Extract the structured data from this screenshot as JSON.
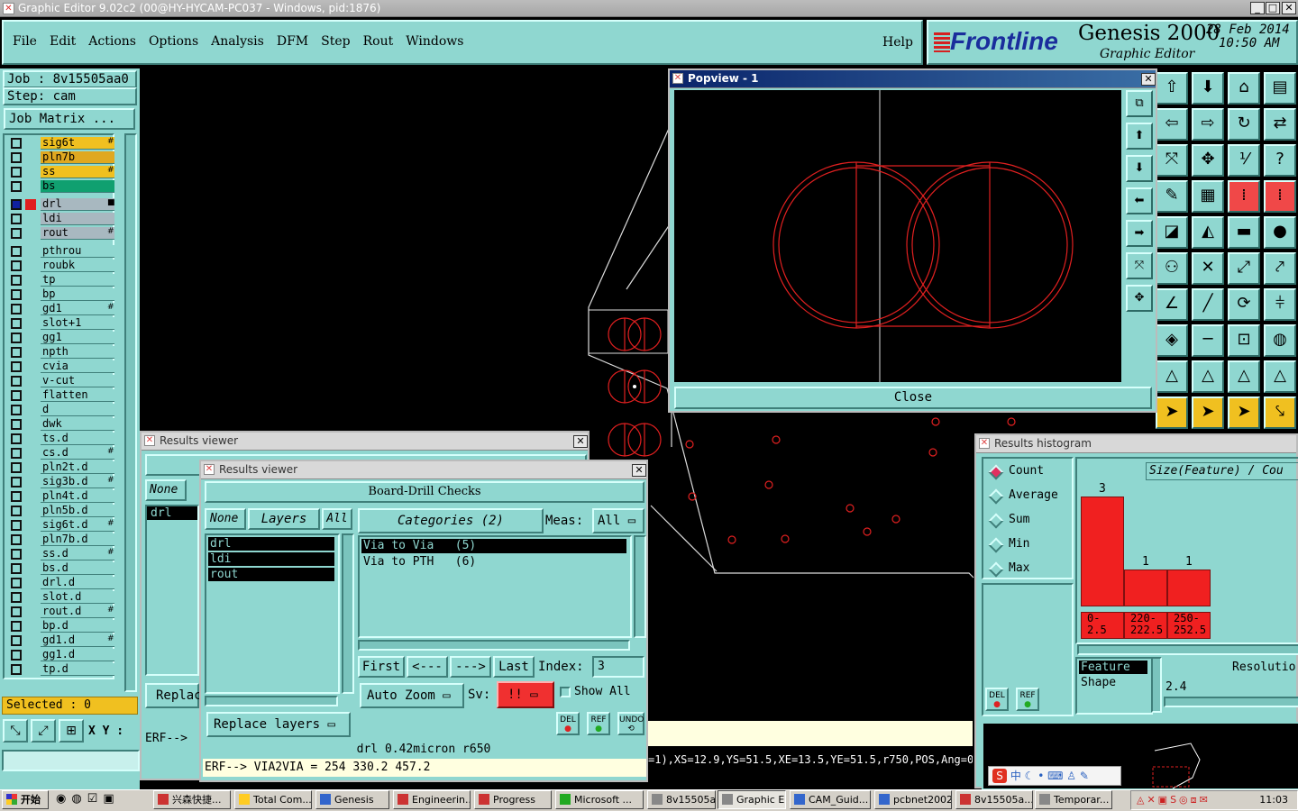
{
  "window": {
    "title": "Graphic Editor 9.02c2 (00@HY-HYCAM-PC037 - Windows, pid:1876)"
  },
  "menu": [
    "File",
    "Edit",
    "Actions",
    "Options",
    "Analysis",
    "DFM",
    "Step",
    "Rout",
    "Windows"
  ],
  "help": "Help",
  "brand": {
    "logo": "Frontline",
    "product": "Genesis 2000",
    "subtitle": "Graphic Editor",
    "date": "28 Feb 2014",
    "time": "10:50 AM"
  },
  "job": {
    "job_label": "Job : 8v15505aa0",
    "step_label": "Step: cam",
    "matrix_button": "Job Matrix ..."
  },
  "layers": [
    {
      "name": "sig6t",
      "color": "#f0c020",
      "mark": "#"
    },
    {
      "name": "pln7b",
      "color": "#e0a820",
      "mark": ""
    },
    {
      "name": "ss",
      "color": "#f0c020",
      "mark": "#"
    },
    {
      "name": "bs",
      "color": "#10a070",
      "mark": ""
    },
    {
      "name": "drl",
      "color": "#a8b8c0",
      "mark": "■",
      "active": true
    },
    {
      "name": "ldi",
      "color": "#a8b8c0",
      "mark": ""
    },
    {
      "name": "rout",
      "color": "#a8b8c0",
      "mark": "#"
    },
    {
      "name": "pthrou",
      "color": "#8fd7d0",
      "mark": ""
    },
    {
      "name": "roubk",
      "color": "#8fd7d0",
      "mark": ""
    },
    {
      "name": "tp",
      "color": "#8fd7d0",
      "mark": ""
    },
    {
      "name": "bp",
      "color": "#8fd7d0",
      "mark": ""
    },
    {
      "name": "gd1",
      "color": "#8fd7d0",
      "mark": "#"
    },
    {
      "name": "slot+1",
      "color": "#8fd7d0",
      "mark": ""
    },
    {
      "name": "gg1",
      "color": "#8fd7d0",
      "mark": ""
    },
    {
      "name": "npth",
      "color": "#8fd7d0",
      "mark": ""
    },
    {
      "name": "cvia",
      "color": "#8fd7d0",
      "mark": ""
    },
    {
      "name": "v-cut",
      "color": "#8fd7d0",
      "mark": ""
    },
    {
      "name": "flatten",
      "color": "#8fd7d0",
      "mark": ""
    },
    {
      "name": "d",
      "color": "#8fd7d0",
      "mark": ""
    },
    {
      "name": "dwk",
      "color": "#8fd7d0",
      "mark": ""
    },
    {
      "name": "ts.d",
      "color": "#8fd7d0",
      "mark": ""
    },
    {
      "name": "cs.d",
      "color": "#8fd7d0",
      "mark": "#"
    },
    {
      "name": "pln2t.d",
      "color": "#8fd7d0",
      "mark": ""
    },
    {
      "name": "sig3b.d",
      "color": "#8fd7d0",
      "mark": "#"
    },
    {
      "name": "pln4t.d",
      "color": "#8fd7d0",
      "mark": ""
    },
    {
      "name": "pln5b.d",
      "color": "#8fd7d0",
      "mark": ""
    },
    {
      "name": "sig6t.d",
      "color": "#8fd7d0",
      "mark": "#"
    },
    {
      "name": "pln7b.d",
      "color": "#8fd7d0",
      "mark": ""
    },
    {
      "name": "ss.d",
      "color": "#8fd7d0",
      "mark": "#"
    },
    {
      "name": "bs.d",
      "color": "#8fd7d0",
      "mark": ""
    },
    {
      "name": "drl.d",
      "color": "#8fd7d0",
      "mark": ""
    },
    {
      "name": "slot.d",
      "color": "#8fd7d0",
      "mark": ""
    },
    {
      "name": "rout.d",
      "color": "#8fd7d0",
      "mark": "#"
    },
    {
      "name": "bp.d",
      "color": "#8fd7d0",
      "mark": ""
    },
    {
      "name": "gd1.d",
      "color": "#8fd7d0",
      "mark": "#"
    },
    {
      "name": "gg1.d",
      "color": "#8fd7d0",
      "mark": ""
    },
    {
      "name": "tp.d",
      "color": "#8fd7d0",
      "mark": ""
    }
  ],
  "selected": "Selected : 0",
  "xy_label": "X Y :",
  "popview": {
    "title": "Popview - 1",
    "close": "Close"
  },
  "results_back": {
    "title": "Results viewer",
    "none": "None",
    "item": "drl",
    "replace": "Replac",
    "erf": "ERF-->"
  },
  "results": {
    "title": "Results viewer",
    "heading": "Board-Drill Checks",
    "none": "None",
    "layers": "Layers",
    "all": "All",
    "categories": "Categories (2)",
    "meas_label": "Meas:",
    "meas_value": "All",
    "layer_items": [
      "drl",
      "ldi",
      "rout"
    ],
    "category_items": [
      "Via to Via   (5)",
      "Via to PTH   (6)"
    ],
    "first": "First",
    "prev": "<---",
    "next": "--->",
    "last": "Last",
    "index_label": "Index:",
    "index_value": "3",
    "auto_zoom": "Auto Zoom",
    "sv": "Sv:",
    "sv_value": "!!",
    "show_all": "Show All",
    "replace_layers": "Replace layers",
    "del": "DEL",
    "ref": "REF",
    "undo": "UNDO",
    "status": "drl 0.42micron  r650",
    "erf": "ERF--> VIA2VIA = 254 330.2 457.2"
  },
  "coord_line": "=1),XS=12.9,YS=51.5,XE=13.5,YE=51.5,r750,POS,Ang=0",
  "histogram": {
    "title": "Results histogram",
    "options": [
      "Count",
      "Average",
      "Sum",
      "Min",
      "Max"
    ],
    "header": "Size(Feature) / Cou",
    "bars": [
      {
        "count": "3",
        "label": "0-\n2.5"
      },
      {
        "count": "1",
        "label": "220-\n222.5"
      },
      {
        "count": "1",
        "label": "250-\n252.5"
      }
    ],
    "feature": "Feature",
    "shape": "Shape",
    "resolution": "Resolutio",
    "res_value": "2.4",
    "del": "DEL",
    "ref": "REF"
  },
  "taskbar": {
    "start": "开始",
    "items": [
      "兴森快捷...",
      "Total Com...",
      "Genesis",
      "Engineerin...",
      "Progress",
      "Microsoft ...",
      "8v15505a...",
      "Graphic E...",
      "CAM_Guid...",
      "pcbnet2002",
      "8v15505a...",
      "Temporar..."
    ],
    "clock": "11:03"
  },
  "ime": "中"
}
